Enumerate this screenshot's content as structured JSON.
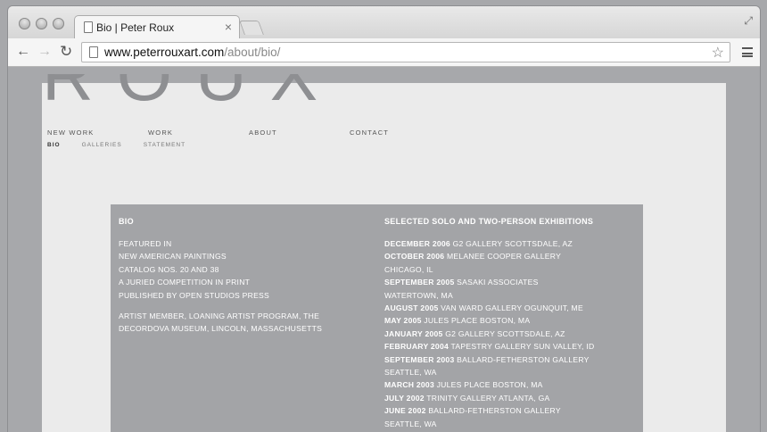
{
  "browser": {
    "tab_title": "Bio | Peter Roux",
    "tab_close": "×",
    "url_host": "www.peterrouxart.com",
    "url_path": "/about/bio/",
    "back": "←",
    "forward": "→",
    "reload": "↻",
    "star": "☆",
    "fullscreen": "⤢"
  },
  "logo": {
    "text": "ROUX"
  },
  "nav": {
    "main": [
      "NEW WORK",
      "WORK",
      "ABOUT",
      "CONTACT"
    ],
    "sub": [
      "BIO",
      "GALLERIES",
      "STATEMENT"
    ],
    "active_sub": "BIO"
  },
  "bio": {
    "heading": "BIO",
    "para1": [
      "FEATURED IN",
      "NEW AMERICAN PAINTINGS",
      "CATALOG NOS. 20 AND 38",
      "A JURIED COMPETITION IN PRINT",
      "PUBLISHED BY OPEN STUDIOS PRESS"
    ],
    "para2": [
      "ARTIST MEMBER, LOANING ARTIST PROGRAM, THE",
      "DECORDOVA MUSEUM, LINCOLN, MASSACHUSETTS"
    ]
  },
  "exhibitions": {
    "heading": "SELECTED SOLO AND TWO-PERSON EXHIBITIONS",
    "items": [
      {
        "date": "DECEMBER 2006",
        "text": " G2 GALLERY SCOTTSDALE, AZ"
      },
      {
        "date": "OCTOBER 2006",
        "text": " MELANEE COOPER GALLERY"
      },
      {
        "date": "",
        "text": "CHICAGO, IL"
      },
      {
        "date": "SEPTEMBER 2005",
        "text": " SASAKI ASSOCIATES"
      },
      {
        "date": "",
        "text": "WATERTOWN, MA"
      },
      {
        "date": "AUGUST 2005",
        "text": " VAN WARD GALLERY OGUNQUIT, ME"
      },
      {
        "date": "MAY 2005",
        "text": " JULES PLACE BOSTON, MA"
      },
      {
        "date": "JANUARY 2005",
        "text": " G2 GALLERY SCOTTSDALE, AZ"
      },
      {
        "date": "FEBRUARY 2004",
        "text": " TAPESTRY GALLERY SUN VALLEY, ID"
      },
      {
        "date": "SEPTEMBER 2003",
        "text": " BALLARD-FETHERSTON GALLERY"
      },
      {
        "date": "",
        "text": "SEATTLE, WA"
      },
      {
        "date": "MARCH 2003",
        "text": " JULES PLACE BOSTON, MA"
      },
      {
        "date": "JULY 2002",
        "text": " TRINITY GALLERY ATLANTA, GA"
      },
      {
        "date": "JUNE 2002",
        "text": " BALLARD-FETHERSTON GALLERY"
      },
      {
        "date": "",
        "text": "SEATTLE, WA"
      }
    ]
  }
}
